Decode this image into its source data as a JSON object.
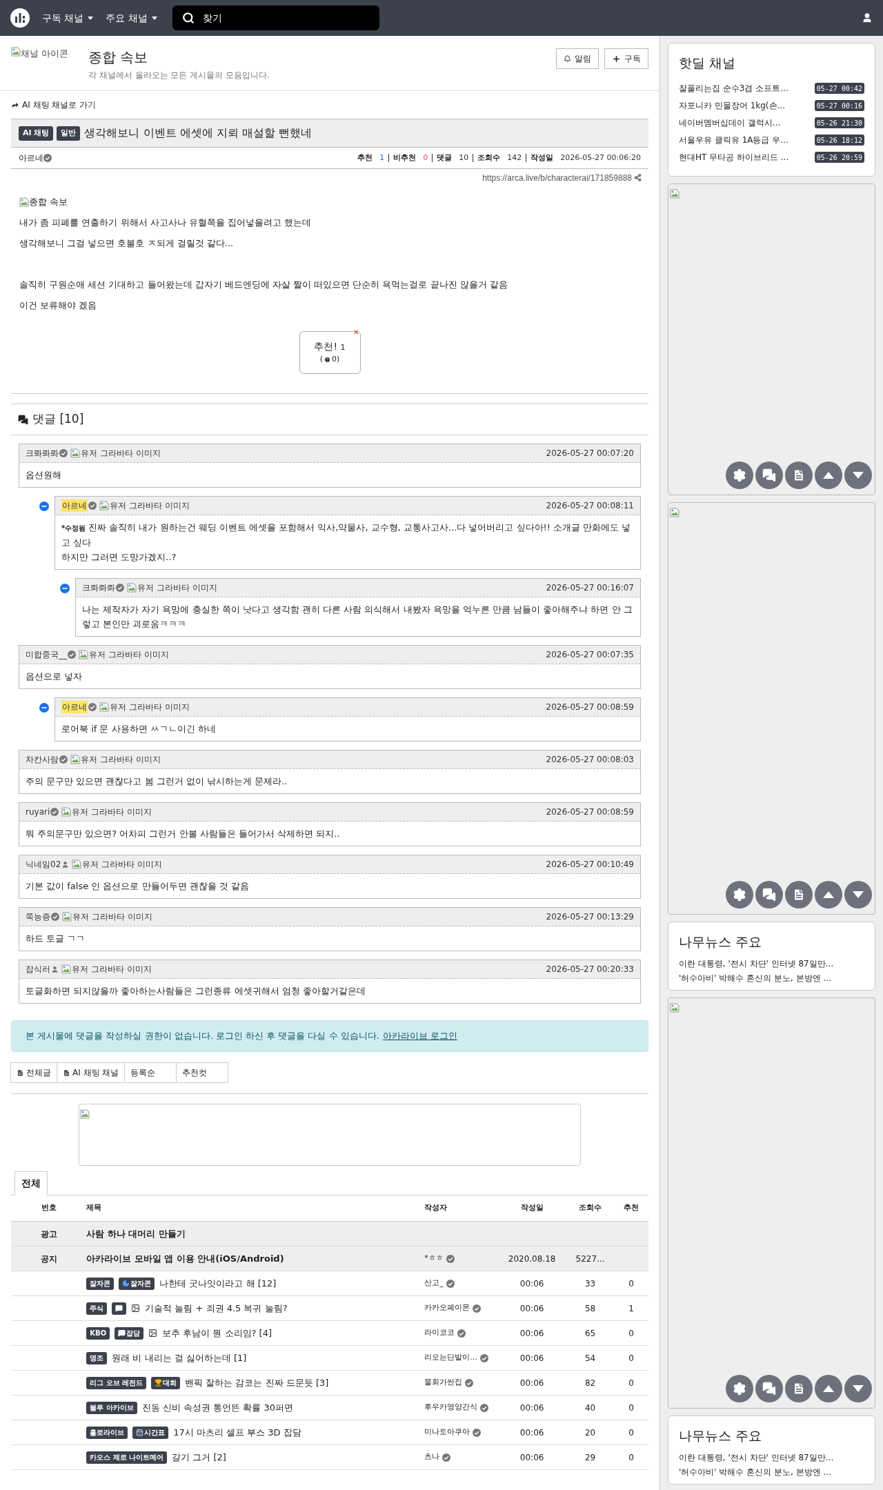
{
  "navbar": {
    "menus": [
      {
        "label": "구독 채널"
      },
      {
        "label": "주요 채널"
      }
    ],
    "search": {
      "placeholder": "찾기"
    }
  },
  "channel": {
    "icon_alt": "채널 아이콘",
    "title": "종합 속보",
    "description": "각 채널에서 올라오는 모든 게시물의 모음입니다.",
    "buttons": [
      {
        "label": "알림",
        "kind": "bell"
      },
      {
        "label": "구독",
        "kind": "plus"
      }
    ]
  },
  "article": {
    "back_link": "AI 채팅 채널로 가기",
    "badges": [
      "AI 채팅",
      "일반"
    ],
    "title": "생각해보니 이벤트 에셋에 지뢰 매설할 뻔했네",
    "author": "아르네",
    "stats": [
      {
        "label": "추천",
        "value": "1",
        "kind": "up"
      },
      {
        "label": "비추천",
        "value": "0",
        "kind": "down"
      },
      {
        "label": "댓글",
        "value": "10",
        "kind": "plain"
      },
      {
        "label": "조회수",
        "value": "142",
        "kind": "plain"
      },
      {
        "label": "작성일",
        "value": "2026-05-27 00:06:20",
        "kind": "plain"
      }
    ],
    "url": "https://arca.live/b/characterai/171859888",
    "image_alt": "종합 속보",
    "paragraph_groups": [
      [
        "내가 좀 피폐를 연출하기 위해서 사고사나 유혈쪽을 집어넣을려고 했는데",
        "생각해보니 그걸 넣으면 호불호 ㅈ되게 걸릴것 같다..."
      ],
      [
        "솔직히 구원순애 세션 기대하고 들어왔는데 갑자기 베드엔딩에 자살 짤이 떠있으면 단순히 욕먹는걸로 끝나진 않을거 같음",
        "이건 보류해야 겠음"
      ]
    ],
    "vote": {
      "label": "추천!",
      "count": "1",
      "open": "(",
      "sub_count": "0",
      "close": ")"
    }
  },
  "comments": {
    "title": "댓글 [10]",
    "items": [
      {
        "author": "크롸롸롸",
        "verified": true,
        "is_author": false,
        "avatar_alt": "유저 그라바타 이미지",
        "time": "2026-05-27 00:07:20",
        "text": "옵션원해",
        "children": [
          {
            "author": "아르네",
            "verified": true,
            "is_author": true,
            "avatar_alt": "유저 그라바타 이미지",
            "time": "2026-05-27 00:08:11",
            "edited_label": "*수정됨",
            "text": "진짜 솔직히 내가 원하는건 웨딩 이벤트 에셋을 포함해서 익사,약물사, 교수형, 교통사고사...다 넣어버리고 싶다아!! 소개글 만화에도 넣고 싶다\n하지만 그러면 도망가겠지..?",
            "children": [
              {
                "author": "크롸롸롸",
                "verified": true,
                "is_author": false,
                "avatar_alt": "유저 그라바타 이미지",
                "time": "2026-05-27 00:16:07",
                "text": "나는 제작자가 자기 욕망에 충실한 쪽이 낫다고 생각함 괜히 다른 사람 의식해서 내봤자 욕망을 억누른 만큼 남들이 좋아해주냐 하면 안 그렇고 본인만 괴로움ㅋㅋㅋ"
              }
            ]
          }
        ]
      },
      {
        "author": "미합중국__",
        "verified": true,
        "is_author": false,
        "avatar_alt": "유저 그라바타 이미지",
        "time": "2026-05-27 00:07:35",
        "text": "옵션으로 넣자",
        "children": [
          {
            "author": "아르네",
            "verified": true,
            "is_author": true,
            "avatar_alt": "유저 그라바타 이미지",
            "time": "2026-05-27 00:08:59",
            "text": "로어북 if 문 사용하면 ㅆㄱㄴ이긴 하네"
          }
        ]
      },
      {
        "author": "차칸사람",
        "verified": true,
        "is_author": false,
        "avatar_alt": "유저 그라바타 이미지",
        "time": "2026-05-27 00:08:03",
        "text": "주의 문구만 있으면 괜찮다고 봄 그런거 없이 낚시하는게 문제라.."
      },
      {
        "author": "ruyari",
        "verified": true,
        "is_author": false,
        "avatar_alt": "유저 그라바타 이미지",
        "time": "2026-05-27 00:08:59",
        "text": "뭐 주의문구만 있으면? 어차피 그런거 안볼 사람들은 들어가서 삭제하면 되지.."
      },
      {
        "author": "닉네임02",
        "verified": false,
        "is_author": false,
        "avatar_alt": "유저 그라바타 이미지",
        "time": "2026-05-27 00:10:49",
        "text": "기본 값이 false 인 옵션으로 만들어두면 괜찮을 것 같음"
      },
      {
        "author": "쭉농증",
        "verified": true,
        "is_author": false,
        "avatar_alt": "유저 그라바타 이미지",
        "time": "2026-05-27 00:13:29",
        "text": "하드 토글 ㄱㄱ"
      },
      {
        "author": "잡식러",
        "verified": false,
        "is_author": false,
        "avatar_alt": "유저 그라바타 이미지",
        "time": "2026-05-27 00:20:33",
        "text": "토글화하면 되지않을까 좋아하는사람들은 그런종류 에셋귀해서 엄청 좋아할거같은데"
      }
    ]
  },
  "login_alert": {
    "text": "본 게시물에 댓글을 작성하실 권한이 없습니다. 로그인 하신 후 댓글을 다실 수 있습니다.",
    "link": "아카라이브 로그인"
  },
  "board_buttons": [
    {
      "label": "전체글",
      "icon": true
    },
    {
      "label": "AI 채팅 채널",
      "icon": true
    },
    {
      "label": "등록순",
      "icon": false
    },
    {
      "label": "추천컷",
      "icon": false
    }
  ],
  "list_tabs": [
    {
      "label": "전체",
      "selected": true
    }
  ],
  "table": {
    "columns": [
      "번호",
      "제목",
      "작성자",
      "작성일",
      "조회수",
      "추천"
    ],
    "rows": [
      {
        "kind": "ad",
        "number": "광고",
        "title": "사람 하나 대머리 만들기"
      },
      {
        "kind": "notice",
        "number": "공지",
        "title": "아카라이브 모바일 앱 이용 안내(iOS/Android)",
        "author": "*ㅎㅎ",
        "date": "2020.08.18",
        "views": "5227..."
      },
      {
        "kind": "post",
        "badges": [
          {
            "label": "잘자콘",
            "kind": "plain"
          },
          {
            "label": "잘자콘",
            "kind": "moon"
          }
        ],
        "has_image": false,
        "title": "나한테 굿나잇이라고 해 [12]",
        "author": "산고_",
        "date": "00:06",
        "views": "33",
        "votes": "0"
      },
      {
        "kind": "post",
        "badges": [
          {
            "label": "주식",
            "kind": "plain"
          },
          {
            "kind": "chat"
          }
        ],
        "has_image": true,
        "title": "기술적 눌림 + 죄권 4.5 복귀 눌림?",
        "author": "카카오페이몬",
        "date": "00:06",
        "views": "58",
        "votes": "1"
      },
      {
        "kind": "post",
        "badges": [
          {
            "label": "KBO",
            "kind": "plain"
          },
          {
            "label": "잡담",
            "kind": "chat"
          }
        ],
        "has_image": true,
        "title": "보추 후남이 뭔 소리임? [4]",
        "author": "라이코코",
        "date": "00:06",
        "views": "65",
        "votes": "0"
      },
      {
        "kind": "post",
        "badges": [
          {
            "label": "명조",
            "kind": "plain"
          }
        ],
        "has_image": false,
        "title": "원래 비 내리는 걸 싫어하는데 [1]",
        "author": "리오는단발이...",
        "date": "00:06",
        "views": "54",
        "votes": "0"
      },
      {
        "kind": "post",
        "badges": [
          {
            "label": "리그 오브 레전드",
            "kind": "plain"
          },
          {
            "label": "대회",
            "kind": "trophy"
          }
        ],
        "has_image": false,
        "title": "밴픽 잘하는 감코는 진짜 드문듯 [3]",
        "author": "물회가싼집",
        "date": "00:06",
        "views": "82",
        "votes": "0"
      },
      {
        "kind": "post",
        "badges": [
          {
            "label": "블루 아카이브",
            "kind": "plain"
          }
        ],
        "has_image": false,
        "title": "진동 신비 속성권 통언뜬 확률 30퍼면",
        "author": "후우카영양간식",
        "date": "00:06",
        "views": "40",
        "votes": "0"
      },
      {
        "kind": "post",
        "badges": [
          {
            "label": "홀로라이브",
            "kind": "plain"
          },
          {
            "label": "시간표",
            "kind": "calendar"
          }
        ],
        "has_image": false,
        "title": "17시 마츠리 셀프 부스 3D 잡담",
        "author": "미나토아쿠아",
        "date": "00:06",
        "views": "20",
        "votes": "0"
      },
      {
        "kind": "post",
        "badges": [
          {
            "label": "카오스 제로 나이트메어",
            "kind": "plain"
          }
        ],
        "has_image": false,
        "title": "갈기 그거 [2]",
        "author": "츠나",
        "date": "00:06",
        "views": "29",
        "votes": "0"
      }
    ]
  },
  "sidebar": {
    "hotdeal": {
      "title": "핫딜 채널",
      "items": [
        {
          "title": "잘풀리는집 순수3겹 소프트...",
          "time": "05-27 00:42"
        },
        {
          "title": "자포니카 민물장어 1kg(손...",
          "time": "05-27 00:16"
        },
        {
          "title": "네이버멤버십데이 갤럭시...",
          "time": "05-26 21:30"
        },
        {
          "title": "서울우유 클릭유 1A등급 우...",
          "time": "05-26 18:12"
        },
        {
          "title": "현대HT 무타공 하이브리드 ...",
          "time": "05-26 20:59"
        }
      ]
    },
    "news": {
      "title": "나무뉴스 주요",
      "items": [
        "이란 대통령, '전시 차단' 인터넷 87일만...",
        "'허수아비' 박해수 혼신의 분노, 본방엔 ..."
      ]
    },
    "news_repeat": {
      "title": "나무뉴스 주요",
      "items": [
        "이란 대통령, '전시 차단' 인터넷 87일만...",
        "'허수아비' 박해수 혼신의 분노, 본방엔 ..."
      ]
    }
  }
}
